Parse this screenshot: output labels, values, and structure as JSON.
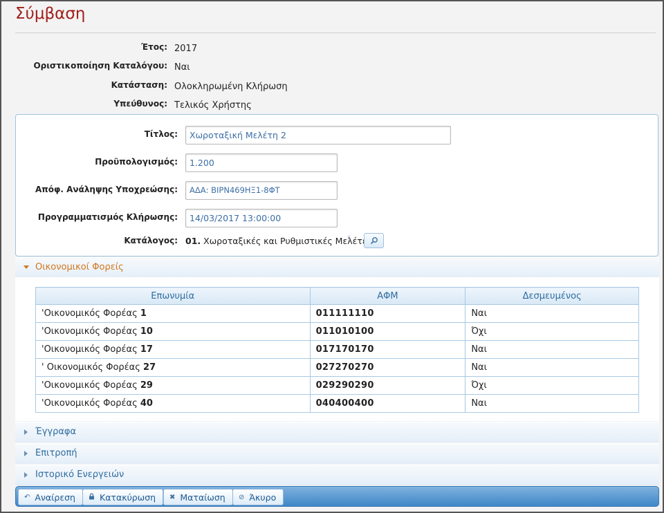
{
  "page": {
    "title": "Σύμβαση"
  },
  "info": {
    "year_label": "Έτος:",
    "year_value": "2017",
    "catalog_finalization_label": "Οριστικοποίηση Καταλόγου:",
    "catalog_finalization_value": "Ναι",
    "status_label": "Κατάσταση:",
    "status_value": "Ολοκληρωμένη Κλήρωση",
    "responsible_label": "Υπεύθυνος:",
    "responsible_value": "Τελικός Χρήστης"
  },
  "form": {
    "title_label": "Τίτλος:",
    "title_value": "Χωροταξική Μελέτη 2",
    "budget_label": "Προϋπολογισμός:",
    "budget_value": "1.200",
    "commitment_label": "Απόφ. Ανάληψης Υποχρεώσης:",
    "commitment_value": "ΑΔΑ: ΒΙΡΝ469ΗΞ1-8ΦΤ",
    "schedule_label": "Προγραμματισμός Κλήρωσης:",
    "schedule_value": "14/03/2017 13:00:00",
    "catalog_label": "Κατάλογος:",
    "catalog_code": "01.",
    "catalog_name": "Χωροταξικές και Ρυθμιστικές Μελέτες"
  },
  "sections": {
    "operators": "Οικονομικοί Φορείς",
    "documents": "Έγγραφα",
    "committee": "Επιτροπή",
    "history": "Ιστορικό Ενεργειών"
  },
  "table": {
    "headers": [
      "Επωνυμία",
      "ΑΦΜ",
      "Δεσμευμένος"
    ],
    "rows": [
      {
        "name_prefix": "'Οικονομικός Φορέας",
        "name_num": "1",
        "afm": "011111110",
        "bound": "Ναι"
      },
      {
        "name_prefix": "'Οικονομικός Φορέας",
        "name_num": "10",
        "afm": "011010100",
        "bound": "Όχι"
      },
      {
        "name_prefix": "'Οικονομικός Φορέας",
        "name_num": "17",
        "afm": "017170170",
        "bound": "Ναι"
      },
      {
        "name_prefix": "' Οικονομικός Φορέας",
        "name_num": "27",
        "afm": "027270270",
        "bound": "Ναι"
      },
      {
        "name_prefix": "'Οικονομικός Φορέας",
        "name_num": "29",
        "afm": "029290290",
        "bound": "Όχι"
      },
      {
        "name_prefix": "'Οικονομικός Φορέας",
        "name_num": "40",
        "afm": "040400400",
        "bound": "Ναι"
      }
    ]
  },
  "toolbar": {
    "revoke_label": "Αναίρεση",
    "award_label": "Κατακύρωση",
    "cancel_label": "Ματαίωση",
    "void_label": "Άκυρο"
  },
  "icons": {
    "revoke": "undo-icon",
    "award": "lock-icon",
    "cancel": "x-icon",
    "void": "prohibited-icon",
    "search": "magnifier-icon",
    "drag": "grip-icon"
  },
  "colors": {
    "title": "#a0201a",
    "accent": "#d2771c",
    "link": "#2e6c9e",
    "toolbar": "#3f86c7"
  }
}
